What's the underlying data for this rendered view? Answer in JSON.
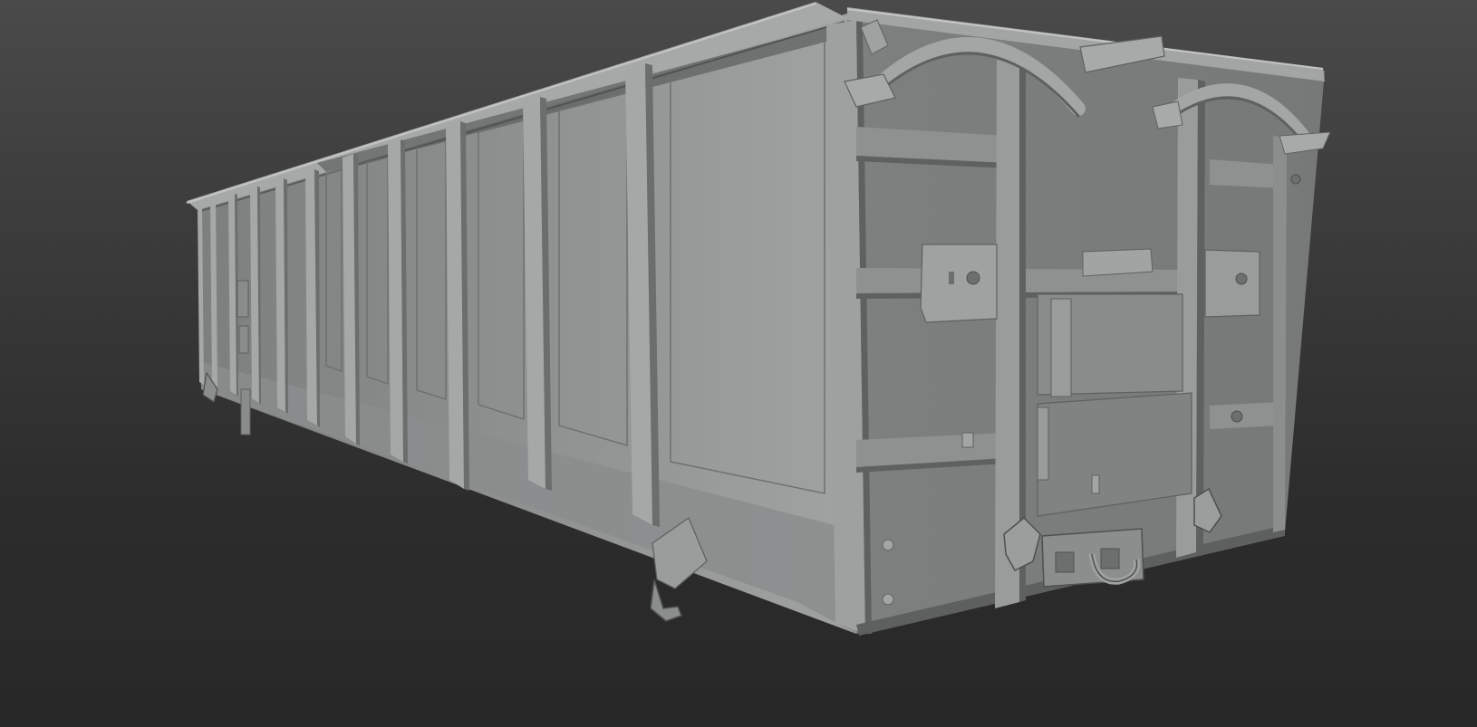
{
  "viewport": {
    "background_top": "#4a4a4a",
    "background_bottom": "#282828"
  },
  "model": {
    "subject": "open-top-freight-wagon-body",
    "side_color": "#9c9e9e",
    "side_shadow": "#7f8181",
    "end_color": "#7b7d7d",
    "rib_color": "#a4a6a6",
    "rib_shadow": "#6a6c6c",
    "edge_dark": "#4e5050",
    "hardware_color": "#8d8f8f"
  }
}
